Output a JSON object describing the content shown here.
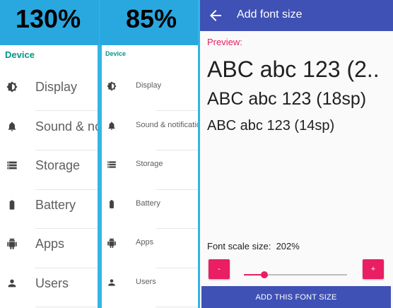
{
  "left_panel": {
    "percent": "130%",
    "section": "Device",
    "items": [
      {
        "label": "Display",
        "icon": "brightness-icon"
      },
      {
        "label": "Sound & notification",
        "icon": "bell-icon"
      },
      {
        "label": "Storage",
        "icon": "storage-icon"
      },
      {
        "label": "Battery",
        "icon": "battery-icon"
      },
      {
        "label": "Apps",
        "icon": "android-icon"
      },
      {
        "label": "Users",
        "icon": "person-icon"
      }
    ]
  },
  "middle_panel": {
    "percent": "85%",
    "section": "Device",
    "items": [
      {
        "label": "Display",
        "icon": "brightness-icon"
      },
      {
        "label": "Sound & notification",
        "icon": "bell-icon"
      },
      {
        "label": "Storage",
        "icon": "storage-icon"
      },
      {
        "label": "Battery",
        "icon": "battery-icon"
      },
      {
        "label": "Apps",
        "icon": "android-icon"
      },
      {
        "label": "Users",
        "icon": "person-icon"
      }
    ]
  },
  "app": {
    "title": "Add font size",
    "preview_label": "Preview:",
    "preview_lines": [
      "ABC abc 123 (2..",
      "ABC abc 123 (18sp)",
      "ABC abc 123 (14sp)"
    ],
    "scale_label": "Font scale size:",
    "scale_value": "202%",
    "minus_label": "-",
    "plus_label": "+",
    "slider_fraction": 0.2,
    "add_button": "ADD THIS FONT SIZE"
  },
  "colors": {
    "outer_background": "#33b5e5",
    "section_teal": "#009688",
    "app_bar": "#3f51b5",
    "accent_pink": "#e91e63"
  }
}
